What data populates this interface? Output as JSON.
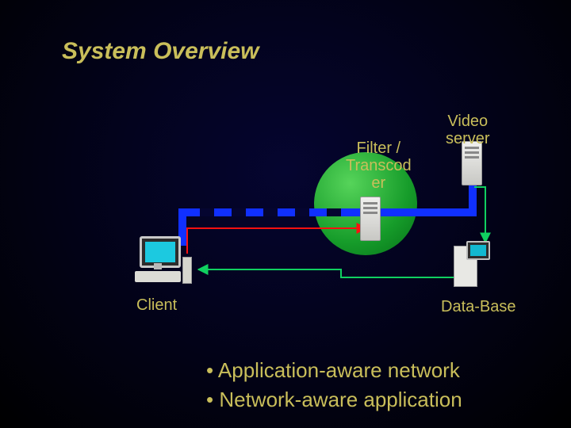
{
  "title": "System Overview",
  "nodes": {
    "filter": "Filter /\nTranscod\ner",
    "video": "Video\nserver",
    "client": "Client",
    "database": "Data-Base"
  },
  "bullets": [
    "Application-aware network",
    "Network-aware application"
  ],
  "icons": {
    "client_pc": "desktop-computer-icon",
    "transcoder": "server-icon",
    "video_server": "server-icon",
    "database": "workstation-icon"
  },
  "colors": {
    "text": "#c9be5a",
    "accent": "#169c2a",
    "flow1": "#1030ff",
    "flow2": "#ff1010",
    "flow3": "#10d060"
  }
}
